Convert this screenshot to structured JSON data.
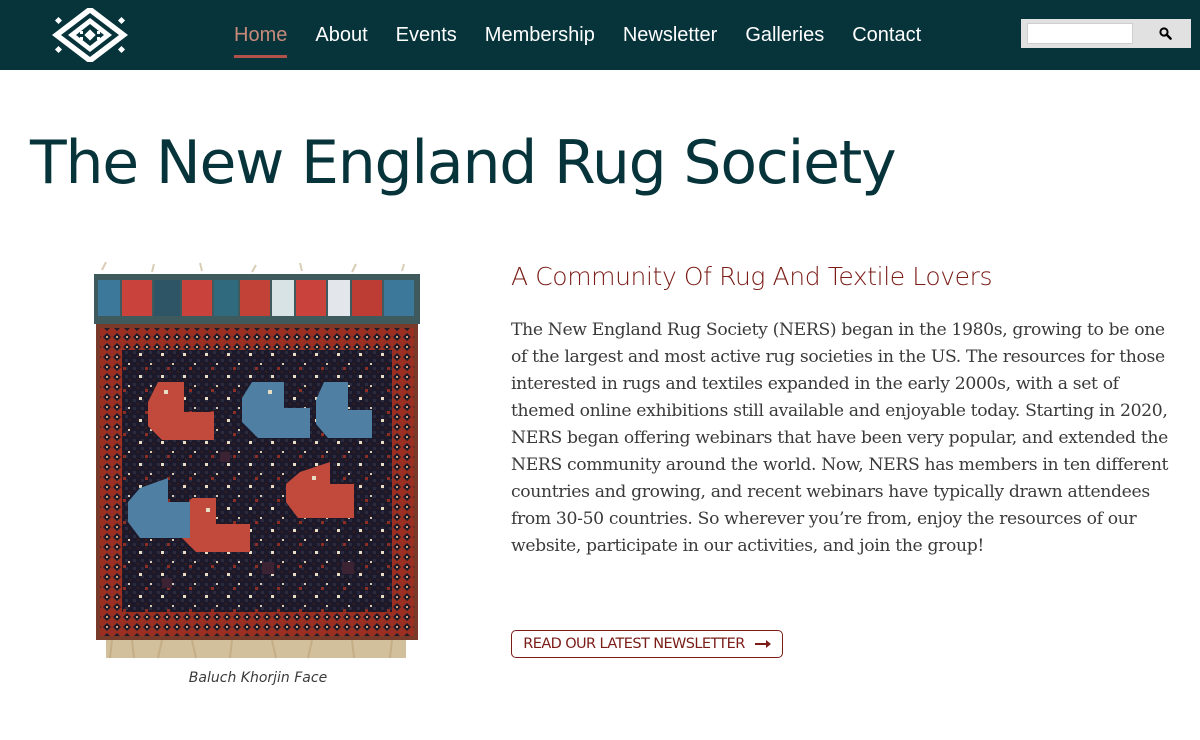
{
  "header": {
    "logo_icon": "geometric-diamond-logo",
    "nav": [
      {
        "label": "Home",
        "active": true
      },
      {
        "label": "About",
        "active": false
      },
      {
        "label": "Events",
        "active": false
      },
      {
        "label": "Membership",
        "active": false
      },
      {
        "label": "Newsletter",
        "active": false
      },
      {
        "label": "Galleries",
        "active": false
      },
      {
        "label": "Contact",
        "active": false
      }
    ],
    "search": {
      "value": "",
      "placeholder": "",
      "button_icon": "search-icon"
    }
  },
  "main": {
    "title": "The New England Rug Society",
    "figure": {
      "caption": "Baluch Khorjin Face"
    },
    "heading": "A Community Of Rug And Textile Lovers",
    "body": "The New England Rug Society (NERS) began in the 1980s, growing to be one of the largest and most active rug societies in the US. The resources for those interested in rugs and textiles expanded in the early 2000s, with a set of themed online exhibitions still available and enjoyable today. Starting in 2020, NERS began offering webinars that have been very popular, and extended the NERS community around the world. Now, NERS has members in ten different countries and growing, and recent webinars have typically drawn attendees from 30-50 countries. So wherever you’re from, enjoy the resources of our website, participate in our activities, and join the group!",
    "cta_label": "READ OUR LATEST NEWSLETTER"
  },
  "colors": {
    "header_bg": "#06343a",
    "nav_active": "#c88a7a",
    "accent": "#7a1c17",
    "title": "#06343a"
  }
}
